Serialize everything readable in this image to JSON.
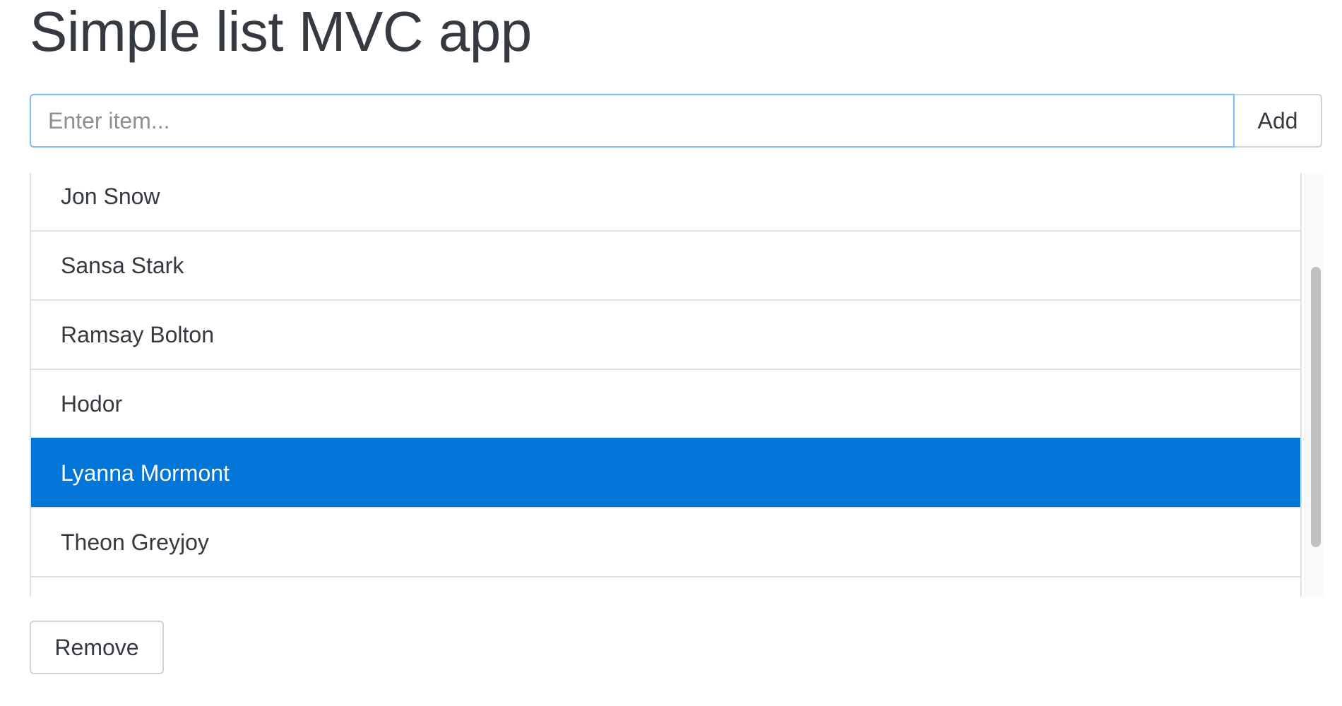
{
  "page": {
    "title": "Simple list MVC app"
  },
  "form": {
    "input_placeholder": "Enter item...",
    "input_value": "",
    "add_label": "Add"
  },
  "list": {
    "items": [
      {
        "label": "Jon Snow",
        "selected": false
      },
      {
        "label": "Sansa Stark",
        "selected": false
      },
      {
        "label": "Ramsay Bolton",
        "selected": false
      },
      {
        "label": "Hodor",
        "selected": false
      },
      {
        "label": "Lyanna Mormont",
        "selected": true
      },
      {
        "label": "Theon Greyjoy",
        "selected": false
      }
    ],
    "selected_index": 4
  },
  "actions": {
    "remove_label": "Remove"
  },
  "colors": {
    "selection": "#0275d8",
    "text": "#343a40",
    "focus_border": "#80bdff"
  }
}
